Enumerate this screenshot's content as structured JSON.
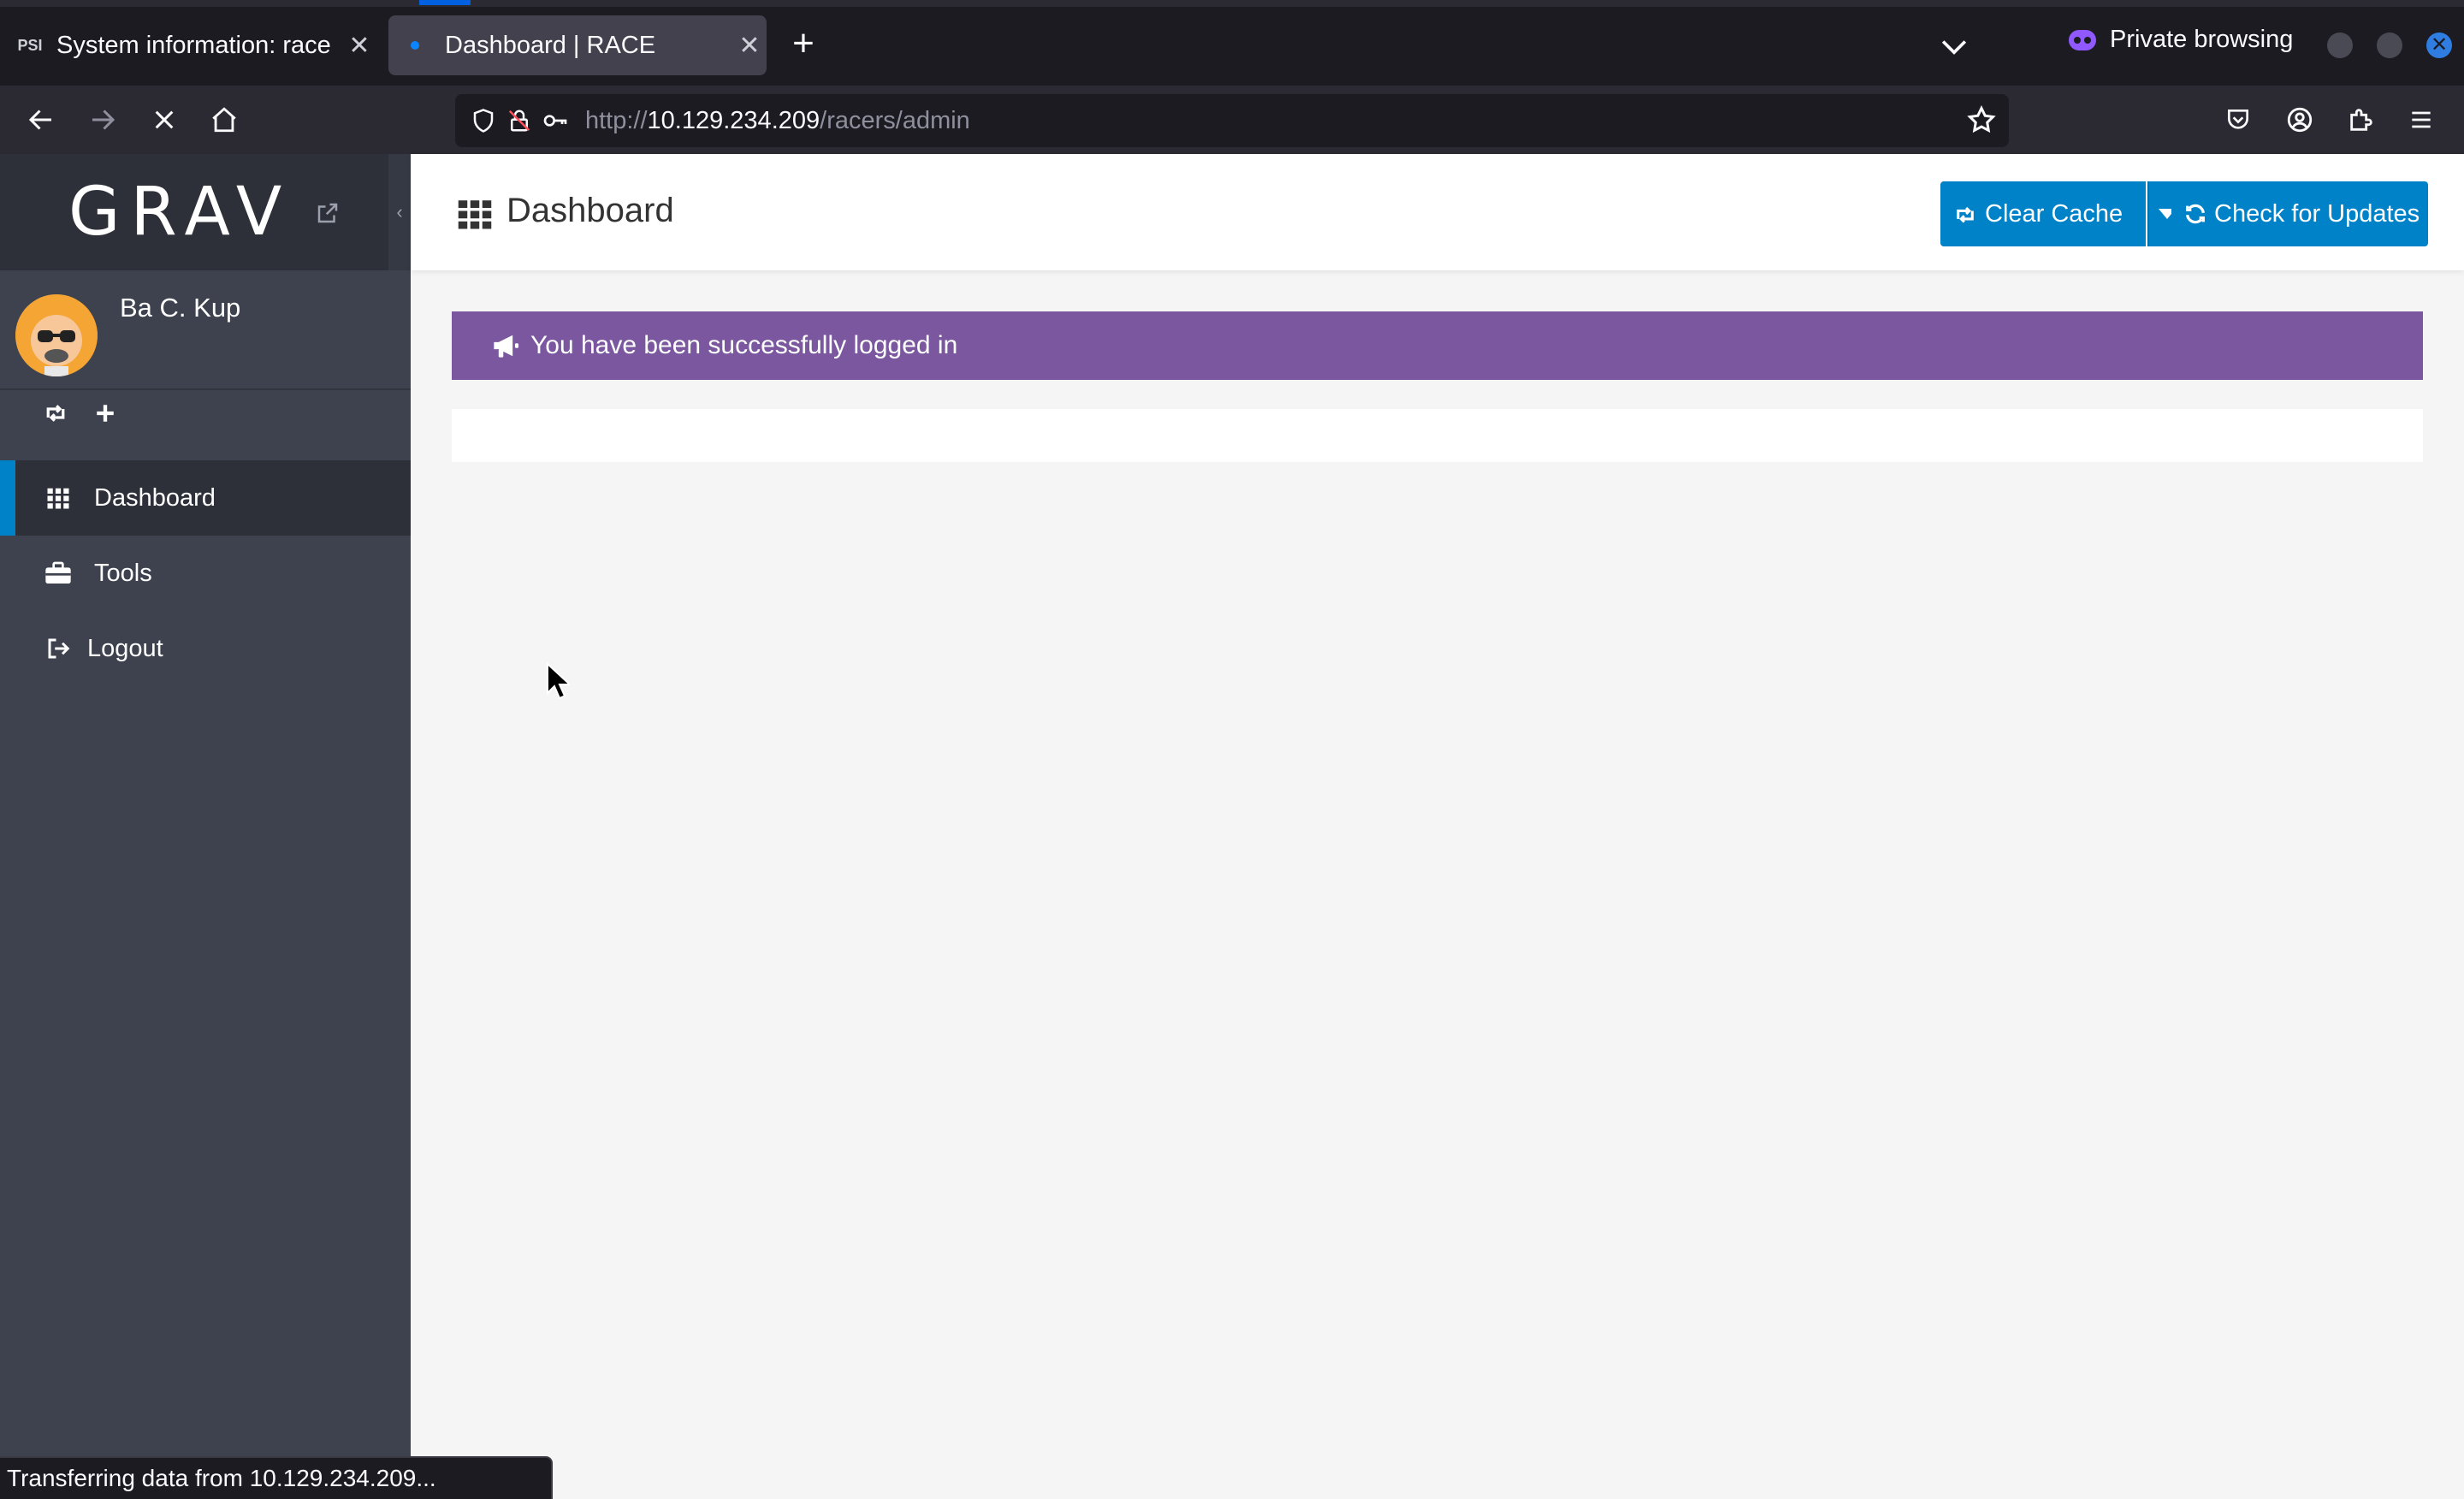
{
  "browser": {
    "tabs": [
      {
        "favicon": "PSI",
        "title": "System information: race",
        "active": false
      },
      {
        "title": "Dashboard | RACE",
        "active": true
      }
    ],
    "private_label": "Private browsing",
    "url_prefix": "http://",
    "url_host": "10.129.234.209",
    "url_path": "/racers/admin",
    "status_text": "Transferring data from 10.129.234.209..."
  },
  "sidebar": {
    "logo": "GRAV",
    "user_name": "Ba C. Kup",
    "items": [
      {
        "label": "Dashboard",
        "icon": "grid-icon",
        "active": true
      },
      {
        "label": "Tools",
        "icon": "briefcase-icon",
        "active": false
      },
      {
        "label": "Logout",
        "icon": "sign-out-icon",
        "active": false
      }
    ]
  },
  "main": {
    "title": "Dashboard",
    "clear_cache_label": "Clear Cache",
    "check_updates_label": "Check for Updates",
    "notice": "You have been successfully logged in"
  },
  "colors": {
    "accent": "#0082c8",
    "notice_bg": "#7a579e",
    "sidebar_bg": "#3d424e"
  }
}
